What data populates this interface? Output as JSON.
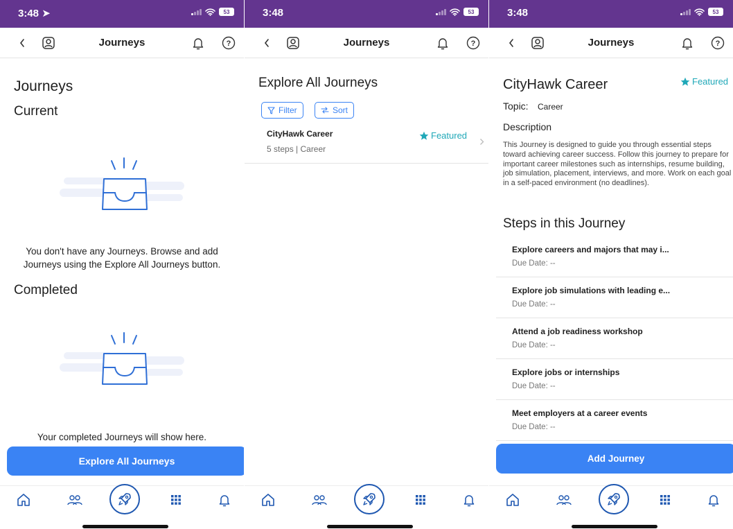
{
  "status": {
    "time_with_arrow": "3:48 ➤",
    "time": "3:48",
    "battery": "53"
  },
  "nav": {
    "title": "Journeys"
  },
  "tabs": [
    "home-icon",
    "people-icon",
    "rocket-icon",
    "grid-icon",
    "bell-icon"
  ],
  "colors": {
    "status_bar": "#63358f",
    "primary": "#3a83f4",
    "featured": "#20a8b8",
    "tab_icon": "#1e57b0"
  },
  "screen1": {
    "heading": "Journeys",
    "current_heading": "Current",
    "current_empty_text": "You don't have any Journeys. Browse and add Journeys using the Explore All Journeys button.",
    "completed_heading": "Completed",
    "completed_empty_text": "Your completed Journeys will show here.",
    "explore_button": "Explore All Journeys"
  },
  "screen2": {
    "heading": "Explore All Journeys",
    "filter_label": "Filter",
    "sort_label": "Sort",
    "journeys": [
      {
        "title": "CityHawk Career",
        "subtitle": "5 steps | Career",
        "badge": "Featured"
      }
    ]
  },
  "screen3": {
    "title": "CityHawk Career",
    "badge": "Featured",
    "topic_label": "Topic:",
    "topic_value": "Career",
    "description_heading": "Description",
    "description": "This Journey is designed to guide you through essential steps toward achieving career success. Follow this journey to prepare for important career milestones such as internships, resume building, job simulation, placement, interviews, and more. Work on each goal in a self-paced environment (no deadlines).",
    "steps_heading": "Steps in this Journey",
    "steps": [
      {
        "title": "Explore careers and majors that may i...",
        "due": "Due Date: --"
      },
      {
        "title": "Explore job simulations with leading e...",
        "due": "Due Date: --"
      },
      {
        "title": "Attend a job readiness workshop",
        "due": "Due Date: --"
      },
      {
        "title": "Explore jobs or internships",
        "due": "Due Date: --"
      },
      {
        "title": "Meet employers at a career events",
        "due": "Due Date: --"
      }
    ],
    "add_button": "Add Journey"
  }
}
